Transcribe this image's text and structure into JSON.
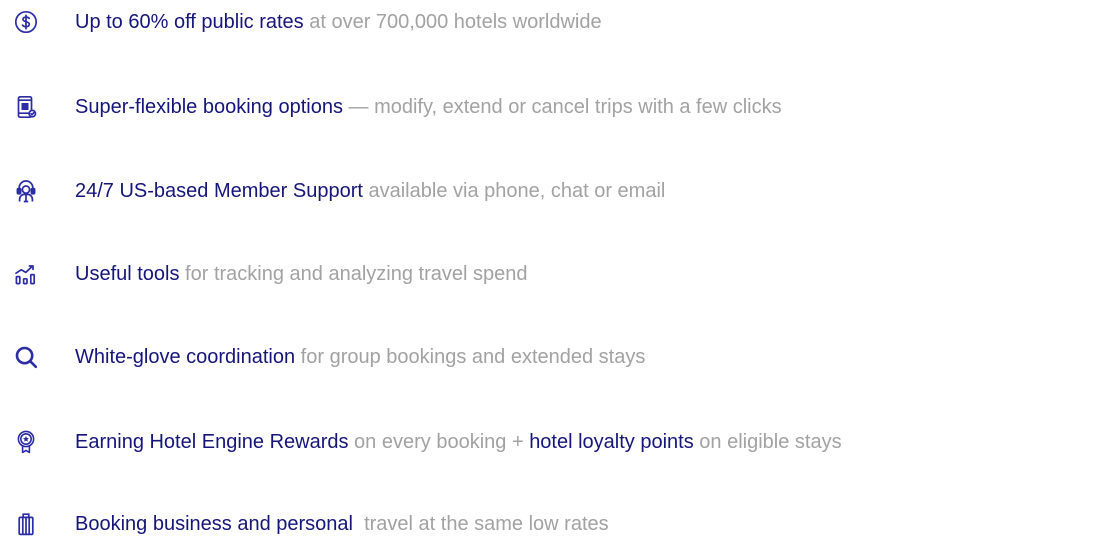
{
  "colors": {
    "accent": "#15157a",
    "icon": "#2c2ca6",
    "muted": "#a2a2a2",
    "background": "#ffffff"
  },
  "benefits": [
    {
      "icon": "dollar-coin-icon",
      "parts": [
        {
          "text": "Up to 60% off public rates",
          "style": "strong"
        },
        {
          "text": " at over 700,000 hotels worldwide",
          "style": "light"
        }
      ]
    },
    {
      "icon": "mobile-booking-icon",
      "parts": [
        {
          "text": "Super-flexible booking options",
          "style": "strong"
        },
        {
          "text": " — modify, extend or cancel trips with a few clicks",
          "style": "light"
        }
      ]
    },
    {
      "icon": "support-agent-icon",
      "parts": [
        {
          "text": "24/7 US-based Member Support",
          "style": "strong"
        },
        {
          "text": " available via phone, chat or email",
          "style": "light"
        }
      ]
    },
    {
      "icon": "analytics-chart-icon",
      "parts": [
        {
          "text": "Useful tools",
          "style": "strong"
        },
        {
          "text": " for tracking and analyzing travel spend",
          "style": "light"
        }
      ]
    },
    {
      "icon": "search-magnifier-icon",
      "parts": [
        {
          "text": "White-glove coordination",
          "style": "strong"
        },
        {
          "text": " for group bookings and extended stays",
          "style": "light"
        }
      ]
    },
    {
      "icon": "rewards-badge-icon",
      "parts": [
        {
          "text": "Earning Hotel Engine Rewards",
          "style": "strong"
        },
        {
          "text": " on every booking + ",
          "style": "light"
        },
        {
          "text": "hotel loyalty points",
          "style": "strong"
        },
        {
          "text": " on eligible stays",
          "style": "light"
        }
      ]
    },
    {
      "icon": "luggage-icon",
      "parts": [
        {
          "text": "Booking business and personal",
          "style": "strong"
        },
        {
          "text": "  travel at the same low rates",
          "style": "light"
        }
      ]
    }
  ]
}
